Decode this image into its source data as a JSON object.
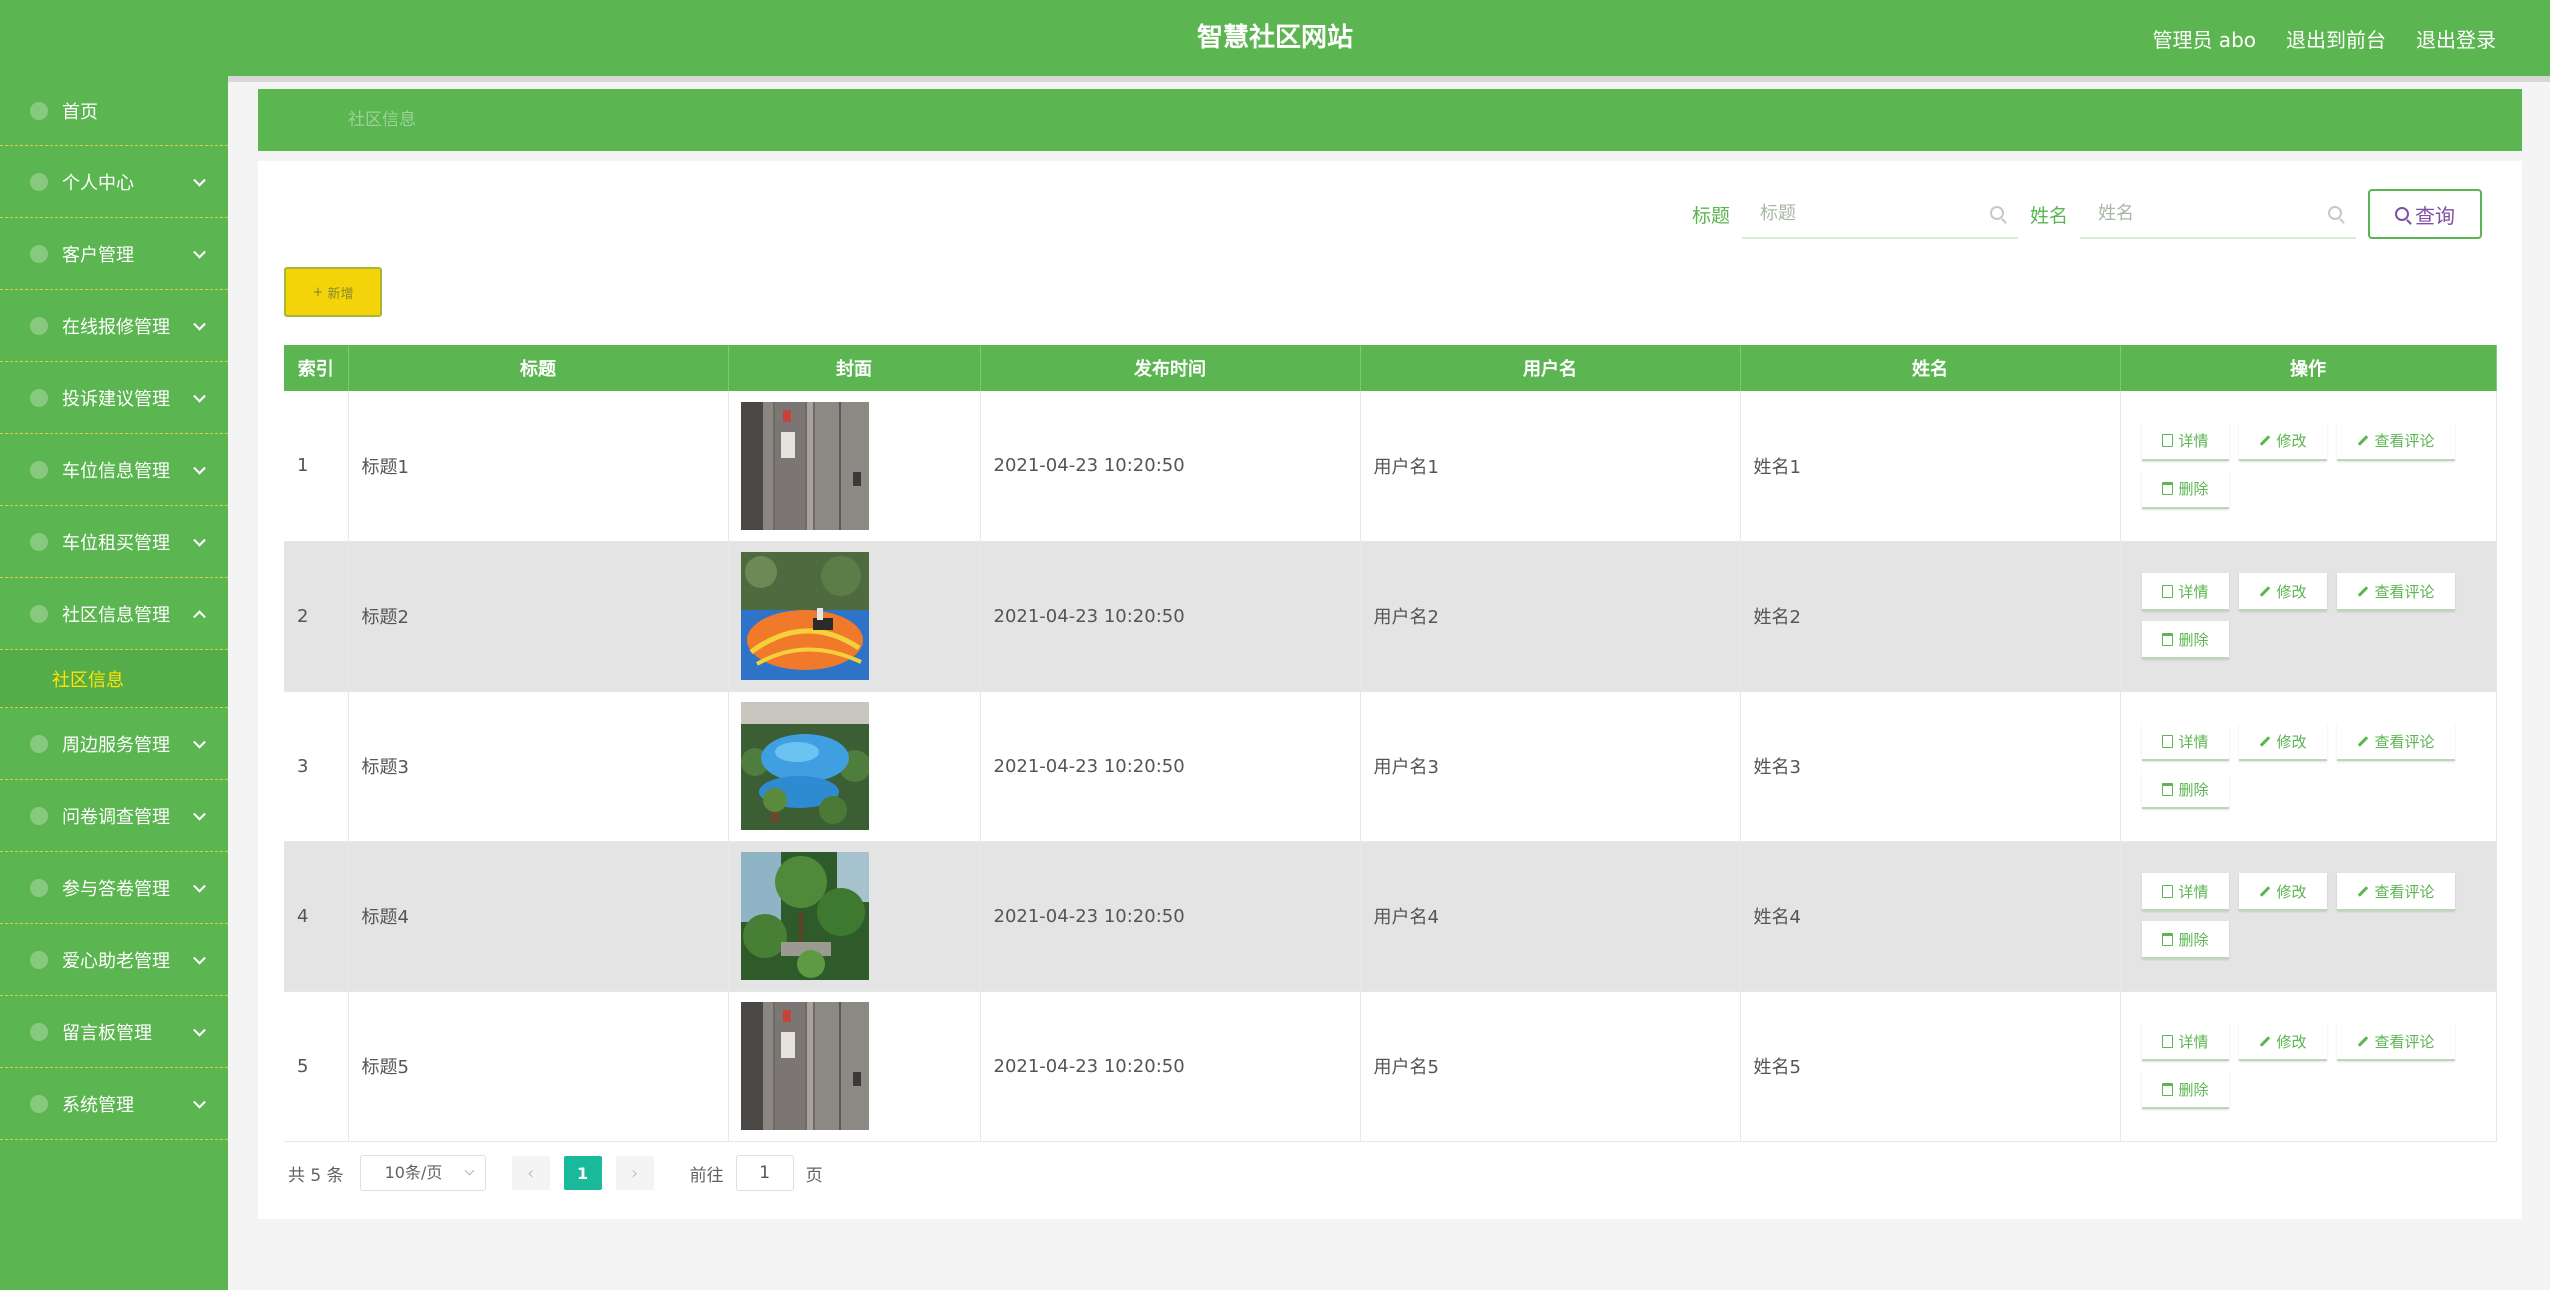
{
  "header": {
    "title": "智慧社区网站",
    "admin": "管理员 abo",
    "to_front": "退出到前台",
    "logout": "退出登录",
    "bg": "#5bb550"
  },
  "sidebar": {
    "items": [
      {
        "label": "首页",
        "icon": "home-icon",
        "expandable": false
      },
      {
        "label": "个人中心",
        "icon": "user-icon",
        "expandable": true
      },
      {
        "label": "客户管理",
        "icon": "customer-icon",
        "expandable": true
      },
      {
        "label": "在线报修管理",
        "icon": "repair-icon",
        "expandable": true
      },
      {
        "label": "投诉建议管理",
        "icon": "complaint-icon",
        "expandable": true
      },
      {
        "label": "车位信息管理",
        "icon": "parking-icon",
        "expandable": true
      },
      {
        "label": "车位租买管理",
        "icon": "rent-icon",
        "expandable": true
      },
      {
        "label": "社区信息管理",
        "icon": "community-icon",
        "expandable": true,
        "expanded": true,
        "sub": [
          "社区信息"
        ]
      },
      {
        "label": "周边服务管理",
        "icon": "service-icon",
        "expandable": true
      },
      {
        "label": "问卷调查管理",
        "icon": "survey-icon",
        "expandable": true
      },
      {
        "label": "参与答卷管理",
        "icon": "answer-icon",
        "expandable": true
      },
      {
        "label": "爱心助老管理",
        "icon": "heart-icon",
        "expandable": true
      },
      {
        "label": "留言板管理",
        "icon": "message-icon",
        "expandable": true
      },
      {
        "label": "系统管理",
        "icon": "system-icon",
        "expandable": true
      }
    ]
  },
  "breadcrumb": {
    "current": "社区信息"
  },
  "search": {
    "title_label": "标题",
    "title_placeholder": "标题",
    "name_label": "姓名",
    "name_placeholder": "姓名",
    "query_button": "查询"
  },
  "toolbar": {
    "add_label": "新增"
  },
  "table": {
    "headers": [
      "索引",
      "标题",
      "封面",
      "发布时间",
      "用户名",
      "姓名",
      "操作"
    ],
    "rows": [
      {
        "index": "1",
        "title": "标题1",
        "cover": "elevator",
        "time": "2021-04-23 10:20:50",
        "username": "用户名1",
        "name": "姓名1"
      },
      {
        "index": "2",
        "title": "标题2",
        "cover": "playground",
        "time": "2021-04-23 10:20:50",
        "username": "用户名2",
        "name": "姓名2"
      },
      {
        "index": "3",
        "title": "标题3",
        "cover": "pool",
        "time": "2021-04-23 10:20:50",
        "username": "用户名3",
        "name": "姓名3"
      },
      {
        "index": "4",
        "title": "标题4",
        "cover": "garden",
        "time": "2021-04-23 10:20:50",
        "username": "用户名4",
        "name": "姓名4"
      },
      {
        "index": "5",
        "title": "标题5",
        "cover": "elevator",
        "time": "2021-04-23 10:20:50",
        "username": "用户名5",
        "name": "姓名5"
      }
    ],
    "actions": {
      "detail": "详情",
      "edit": "修改",
      "comments": "查看评论",
      "delete": "删除"
    }
  },
  "pagination": {
    "total": "共 5 条",
    "page_size": "10条/页",
    "current_page": "1",
    "goto_prefix": "前往",
    "goto_value": "1",
    "goto_suffix": "页"
  }
}
